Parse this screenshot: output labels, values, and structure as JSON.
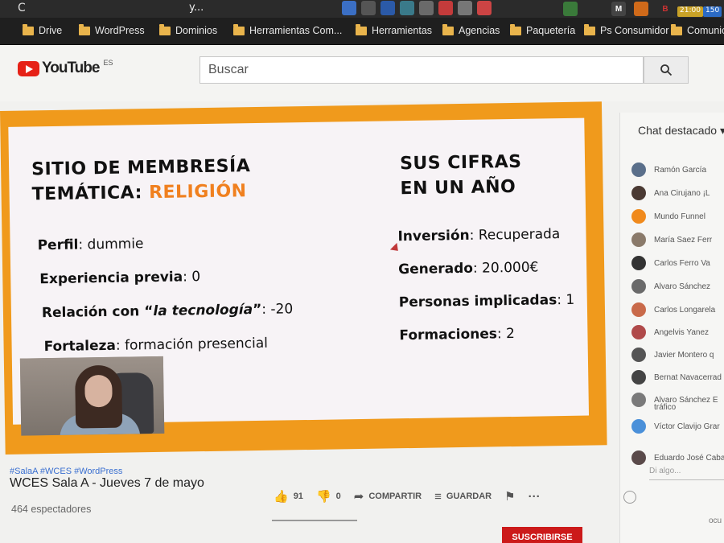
{
  "browser": {
    "tab_title": "y...",
    "nav_back": "C",
    "extension_badges": [
      "M",
      "B"
    ],
    "badge_time": "21:00",
    "badge_count": "150"
  },
  "bookmarks": [
    "Drive",
    "WordPress",
    "Dominios",
    "Herramientas Com...",
    "Herramientas",
    "Agencias",
    "Paquetería",
    "Ps Consumidor",
    "Comunica"
  ],
  "youtube": {
    "logo_word": "YouTube",
    "logo_region": "ES",
    "search_placeholder": "Buscar"
  },
  "slide": {
    "left_title_line1": "SITIO DE MEMBRESÍA",
    "left_title_line2_prefix": "TEMÁTICA: ",
    "left_title_line2_accent": "RELIGIÓN",
    "right_title_line1": "SUS CIFRAS",
    "right_title_line2": "EN UN AÑO",
    "left_rows": [
      {
        "label": "Perfil",
        "value": ": dummie"
      },
      {
        "label": "Experiencia previa",
        "value": ": 0"
      },
      {
        "label": "Relación con “",
        "label_italic": "la tecnología",
        "label_end": "”",
        "value": ": -20"
      },
      {
        "label": "Fortaleza",
        "value": ": formación presencial"
      }
    ],
    "right_rows": [
      {
        "label": "Inversión",
        "value": ": Recuperada"
      },
      {
        "label": "Generado",
        "value": ": 20.000€"
      },
      {
        "label": "Personas implicadas",
        "value": ": 1"
      },
      {
        "label": "Formaciones",
        "value": ": 2"
      }
    ]
  },
  "video_info": {
    "hashtags": "#SalaA #WCES #WordPress",
    "title": "WCES Sala A - Jueves 7 de mayo",
    "viewers": "464 espectadores",
    "likes": "91",
    "dislikes": "0",
    "share_label": "COMPARTIR",
    "save_label": "GUARDAR",
    "subscribe_label": "SUSCRIBIRSE"
  },
  "chat": {
    "header": "Chat destacado",
    "messages": [
      {
        "name": "Ramón García",
        "color": "#5a6f8a"
      },
      {
        "name": "Ana Cirujano  ¡L",
        "color": "#4a3a33"
      },
      {
        "name": "Mundo Funnel",
        "color": "#f08a1c"
      },
      {
        "name": "María Saez Ferr",
        "color": "#8a7a6a"
      },
      {
        "name": "Carlos Ferro  Va",
        "color": "#333333"
      },
      {
        "name": "Alvaro Sánchez",
        "color": "#6a6a6a"
      },
      {
        "name": "Carlos Longarela",
        "color": "#c96a4a"
      },
      {
        "name": "Angelvis Yanez",
        "color": "#b04a4a"
      },
      {
        "name": "Javier Montero  q",
        "color": "#555555"
      },
      {
        "name": "Bernat Navacerrad",
        "color": "#444444"
      },
      {
        "name": "Alvaro Sánchez  E",
        "color": "#7a7a7a"
      },
      {
        "name": "Víctor Clavijo  Grar",
        "color": "#4a90d9"
      },
      {
        "name": "Eduardo José Caba",
        "color": "#5a4a4a"
      }
    ],
    "extra_line": "tráfico",
    "input_placeholder": "Di algo...",
    "footer": "ocu"
  }
}
